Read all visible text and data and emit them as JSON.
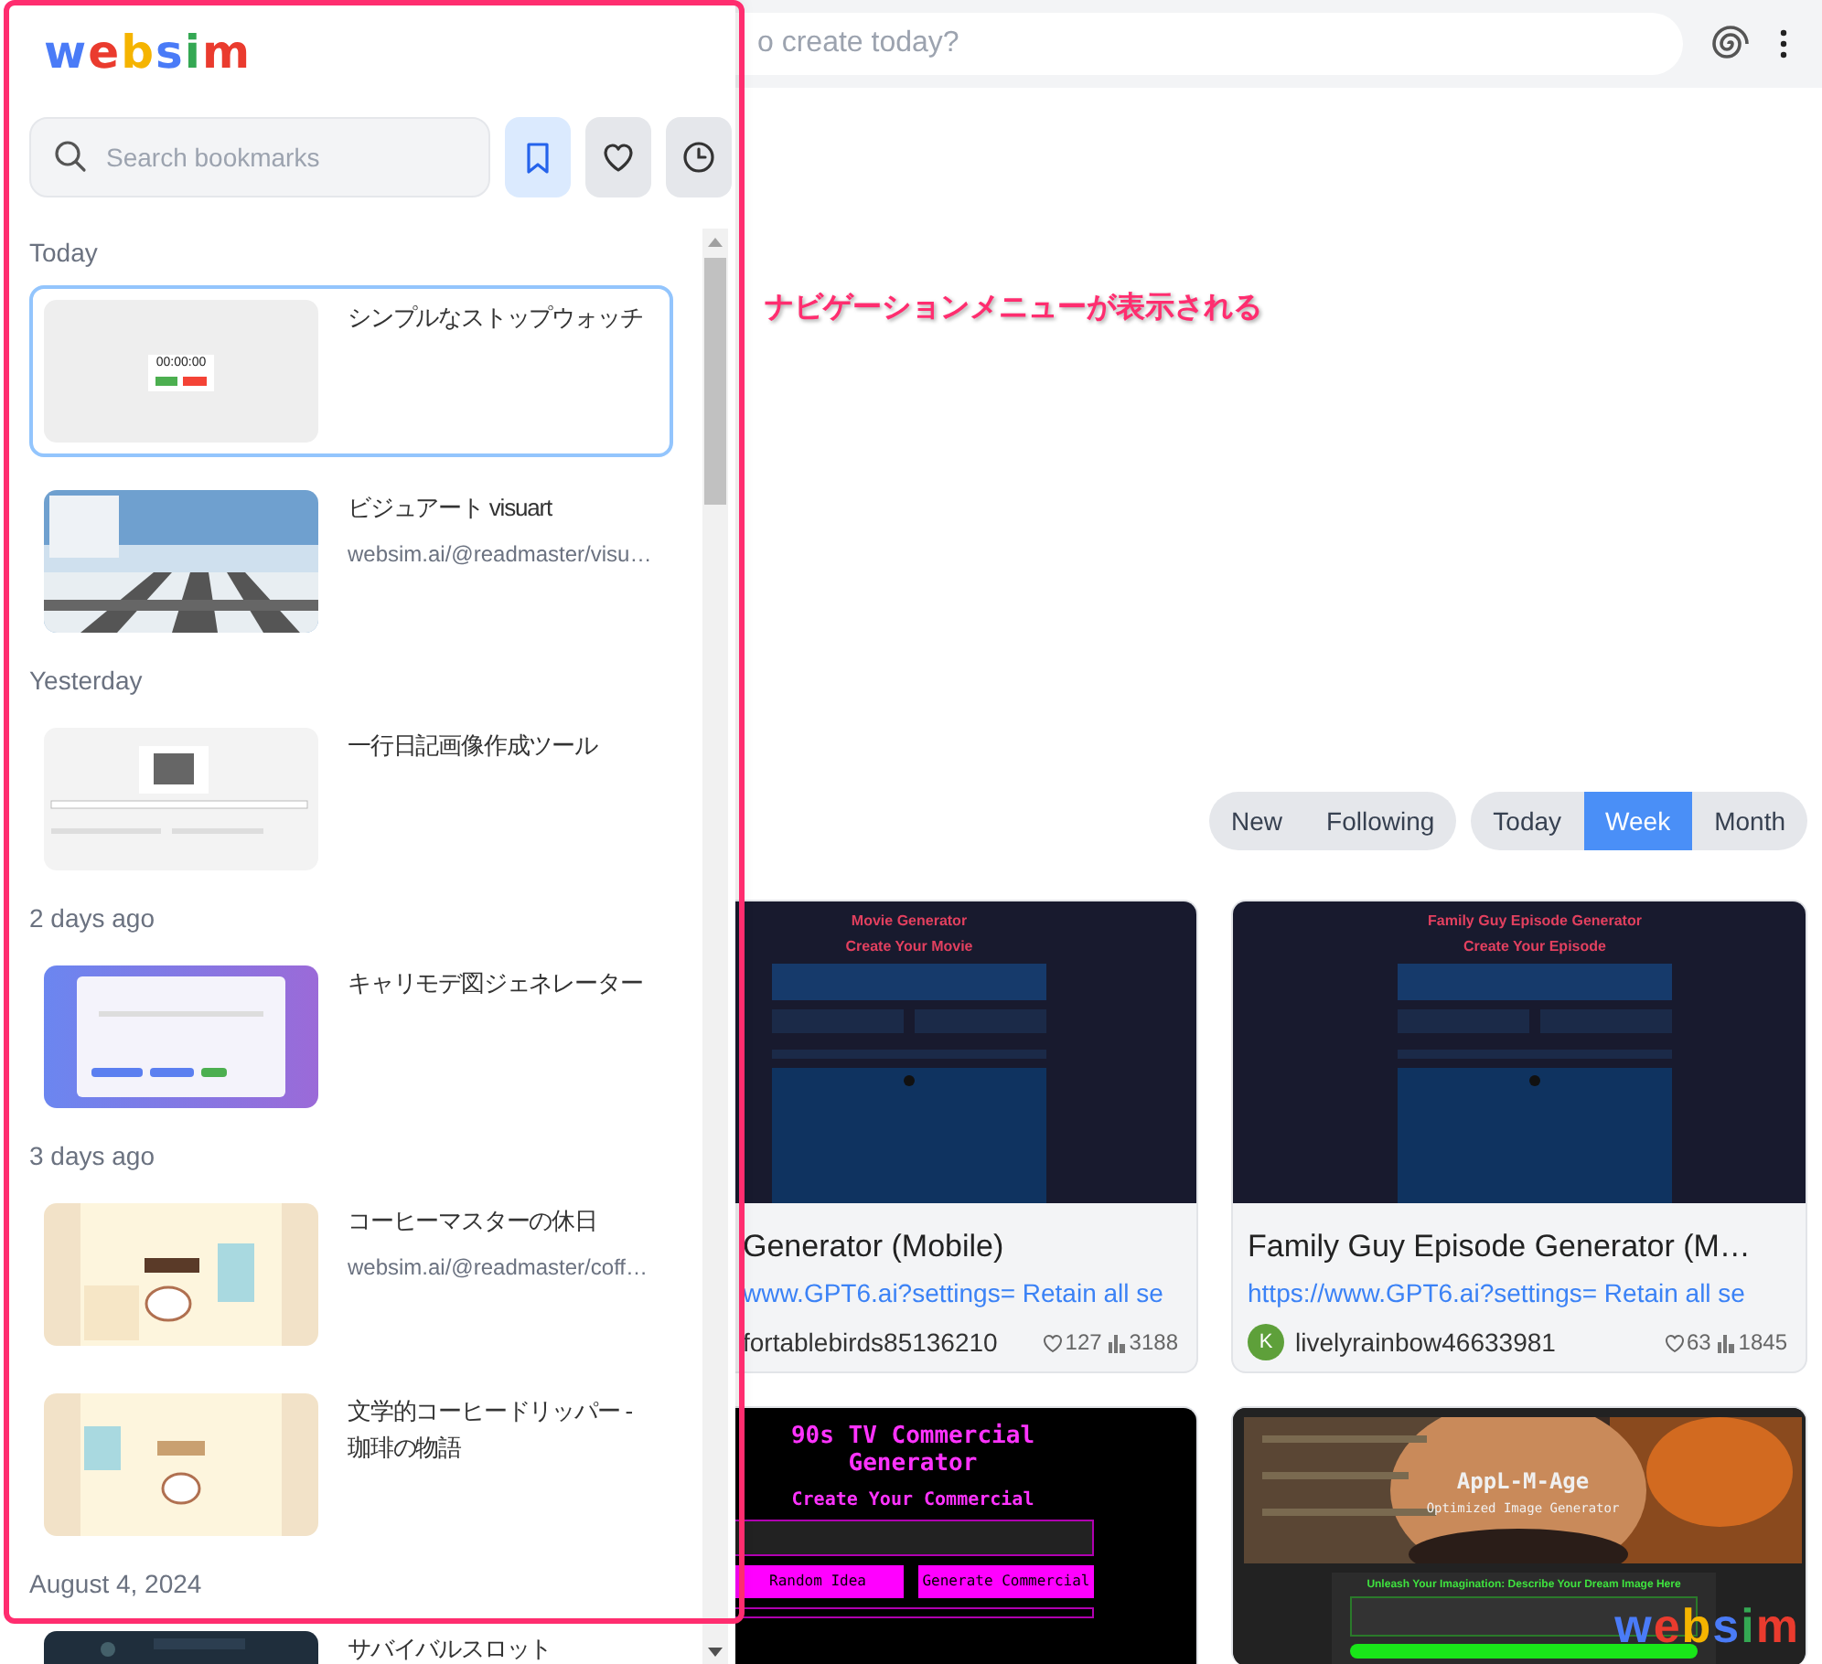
{
  "top_bar": {
    "prompt_placeholder": "o create today?"
  },
  "annotation": "ナビゲーションメニューが表示される",
  "sidebar": {
    "logo": "websim",
    "search": {
      "placeholder": "Search bookmarks"
    },
    "filters": [
      {
        "kind": "bookmark",
        "selected": true
      },
      {
        "kind": "heart",
        "selected": false
      },
      {
        "kind": "clock",
        "selected": false
      }
    ],
    "groups": [
      {
        "label": "Today",
        "items": [
          {
            "title": "シンプルなストップウォッチ",
            "preview_text": "00:00:00",
            "selected": true
          },
          {
            "title": "ビジュアート visuart",
            "url": "websim.ai/@readmaster/visu…",
            "selected": false
          }
        ]
      },
      {
        "label": "Yesterday",
        "items": [
          {
            "title": "一行日記画像作成ツール",
            "selected": false
          }
        ]
      },
      {
        "label": "2 days ago",
        "items": [
          {
            "title": "キャリモデ図ジェネレーター",
            "selected": false
          }
        ]
      },
      {
        "label": "3 days ago",
        "items": [
          {
            "title": "コーヒーマスターの休日",
            "url": "websim.ai/@readmaster/coff…",
            "selected": false
          },
          {
            "title": "文学的コーヒードリッパー - 珈琲の物語",
            "selected": false
          }
        ]
      },
      {
        "label": "August 4, 2024",
        "items": [
          {
            "title": "サバイバルスロット",
            "selected": false
          }
        ]
      }
    ]
  },
  "feed": {
    "sort_tabs": [
      {
        "label": "New",
        "selected": false
      },
      {
        "label": "Following",
        "selected": false
      }
    ],
    "period_tabs": [
      {
        "label": "Today",
        "selected": false
      },
      {
        "label": "Week",
        "selected": true
      },
      {
        "label": "Month",
        "selected": false
      }
    ],
    "cards": [
      {
        "kind": "generator",
        "preview": {
          "title": "Movie Generator",
          "subtitle": "Create Your Movie"
        },
        "title": "Generator (Mobile)",
        "link": "www.GPT6.ai?settings= Retain all se",
        "author": "fortablebirds85136210",
        "likes": "127",
        "views": "3188"
      },
      {
        "kind": "generator",
        "preview": {
          "title": "Family Guy Episode Generator",
          "subtitle": "Create Your Episode"
        },
        "title": "Family Guy Episode Generator (M…",
        "link": "https://www.GPT6.ai?settings= Retain all se",
        "avatar": "K",
        "author": "livelyrainbow46633981",
        "likes": "63",
        "views": "1845"
      },
      {
        "kind": "retro",
        "preview": {
          "title": "90s TV Commercial Generator",
          "subtitle": "Create Your Commercial",
          "buttons": [
            "Random Idea",
            "Generate Commercial"
          ]
        }
      },
      {
        "preview": {
          "title": "AppL-M-Age",
          "subtitle": "Optimized Image Generator",
          "prompt_label": "Unleash Your Imagination: Describe Your Dream Image Here"
        }
      }
    ]
  },
  "floating_logo": "websim"
}
